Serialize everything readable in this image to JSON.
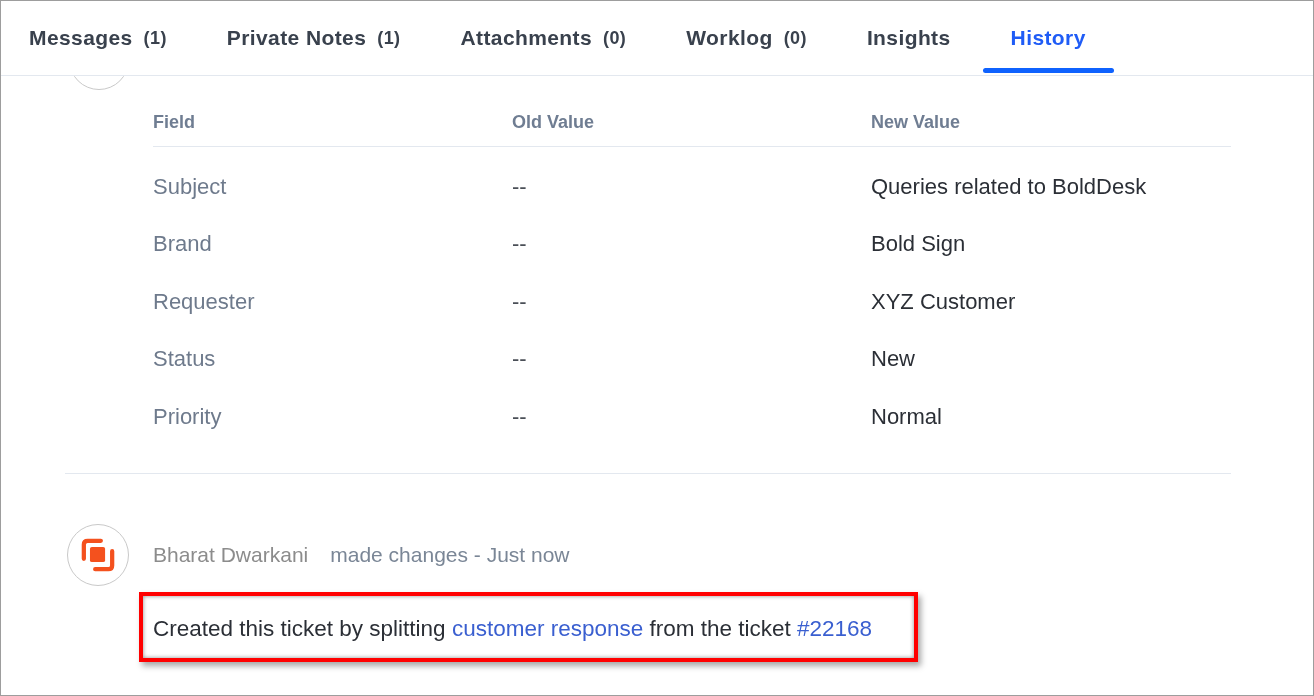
{
  "tabs": [
    {
      "label": "Messages",
      "count": "(1)",
      "selected": false
    },
    {
      "label": "Private Notes",
      "count": "(1)",
      "selected": false
    },
    {
      "label": "Attachments",
      "count": "(0)",
      "selected": false
    },
    {
      "label": "Worklog",
      "count": "(0)",
      "selected": false
    },
    {
      "label": "Insights",
      "selected": false
    },
    {
      "label": "History",
      "selected": true
    }
  ],
  "history_table": {
    "columns": [
      "Field",
      "Old Value",
      "New Value"
    ],
    "rows": [
      {
        "field": "Subject",
        "old_value": "--",
        "new_value": "Queries related to BoldDesk"
      },
      {
        "field": "Brand",
        "old_value": "--",
        "new_value": "Bold Sign"
      },
      {
        "field": "Requester",
        "old_value": "--",
        "new_value": "XYZ Customer"
      },
      {
        "field": "Status",
        "old_value": "--",
        "new_value": "New"
      },
      {
        "field": "Priority",
        "old_value": "--",
        "new_value": "Normal"
      }
    ]
  },
  "entry": {
    "author": "Bharat Dwarkani",
    "action": "made changes - Just now",
    "message": [
      {
        "kind": "text",
        "text": "Created this ticket by splitting "
      },
      {
        "kind": "link",
        "text": "customer response"
      },
      {
        "kind": "text",
        "text": " from the ticket "
      },
      {
        "kind": "link",
        "text": "#22168"
      }
    ]
  }
}
